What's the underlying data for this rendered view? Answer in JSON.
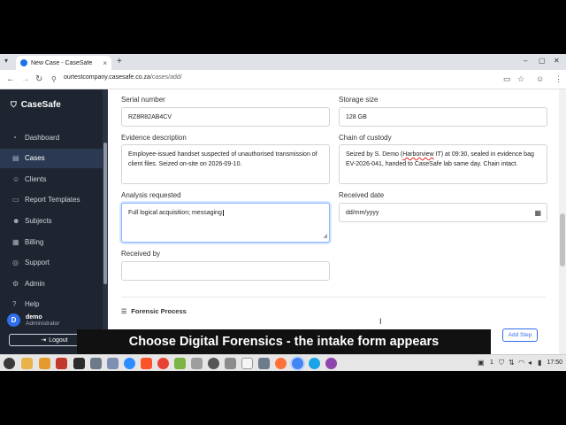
{
  "browser": {
    "tab_title": "New Case - CaseSafe",
    "tab_close": "×",
    "new_tab": "+",
    "url_host": "ourtestcompany.casesafe.co.za",
    "url_path": "/cases/add/"
  },
  "sidebar": {
    "brand": "CaseSafe",
    "items": [
      {
        "label": "Dashboard",
        "icon": "gauge-icon",
        "glyph": "◔"
      },
      {
        "label": "Cases",
        "icon": "folder-icon",
        "glyph": "▤"
      },
      {
        "label": "Clients",
        "icon": "users-icon",
        "glyph": "☺"
      },
      {
        "label": "Report Templates",
        "icon": "document-icon",
        "glyph": "▭"
      },
      {
        "label": "Subjects",
        "icon": "user-icon",
        "glyph": "☻"
      },
      {
        "label": "Billing",
        "icon": "receipt-icon",
        "glyph": "▦"
      },
      {
        "label": "Support",
        "icon": "lifebuoy-icon",
        "glyph": "◎"
      },
      {
        "label": "Admin",
        "icon": "gear-icon",
        "glyph": "⚙"
      },
      {
        "label": "Help",
        "icon": "question-icon",
        "glyph": "?"
      }
    ],
    "active": "Cases",
    "user": {
      "initial": "D",
      "name": "demo",
      "role": "Administrator"
    },
    "logout": "Logout"
  },
  "form": {
    "serial_number": {
      "label": "Serial number",
      "value": "RZ8R82AB4CV"
    },
    "storage_size": {
      "label": "Storage size",
      "value": "128 GB"
    },
    "evidence_description": {
      "label": "Evidence description",
      "value": "Employee-issued handset suspected of unauthorised transmission of client files. Seized on-site on 2026-09-10."
    },
    "chain_of_custody": {
      "label": "Chain of custody",
      "value_before": "Seized by S. Demo (",
      "value_flag": "Harborview",
      "value_after": " IT) at 09:30, sealed in evidence bag EV-2026-041, handed to CaseSafe lab same day. Chain intact."
    },
    "analysis_requested": {
      "label": "Analysis requested",
      "value": "Full logical acquisition; messaging"
    },
    "received_date": {
      "label": "Received date",
      "placeholder": "dd/mm/yyyy"
    },
    "received_by": {
      "label": "Received by",
      "value": ""
    },
    "forensic_process": "Forensic Process",
    "add_step": "Add Step"
  },
  "caption": "Choose Digital Forensics - the intake form appears",
  "taskbar": {
    "clock": "17:50",
    "workspace": "1"
  }
}
